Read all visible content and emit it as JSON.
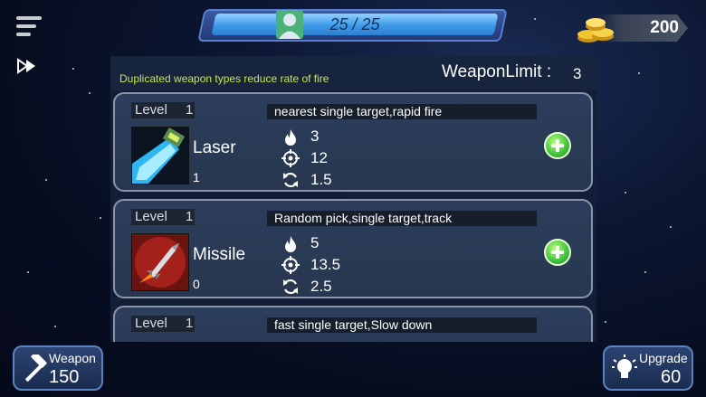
{
  "hud": {
    "health_text": "25 / 25",
    "health_fraction": 1.0,
    "gold": "200"
  },
  "panel": {
    "notice": "Duplicated weapon types reduce rate of fire",
    "weapon_limit_label": "WeaponLimit :",
    "weapon_limit_value": "3"
  },
  "weapons": [
    {
      "level_label": "Level",
      "level": "1",
      "description": "nearest single target,rapid fire",
      "name": "Laser",
      "count": "1",
      "damage": "3",
      "range": "12",
      "fire_rate": "1.5"
    },
    {
      "level_label": "Level",
      "level": "1",
      "description": "Random pick,single target,track",
      "name": "Missile",
      "count": "0",
      "damage": "5",
      "range": "13.5",
      "fire_rate": "2.5"
    },
    {
      "level_label": "Level",
      "level": "1",
      "description": "fast single target,Slow down"
    }
  ],
  "bottom": {
    "weapon_label": "Weapon",
    "weapon_value": "150",
    "upgrade_label": "Upgrade",
    "upgrade_value": "60"
  },
  "icons": {
    "damage": "fire-icon",
    "range": "crosshair-icon",
    "fire_rate": "reload-icon",
    "add": "plus-icon"
  },
  "colors": {
    "notice": "#c8e84a",
    "health_fill": "#3f9ae8",
    "add_button": "#3fc03a"
  }
}
